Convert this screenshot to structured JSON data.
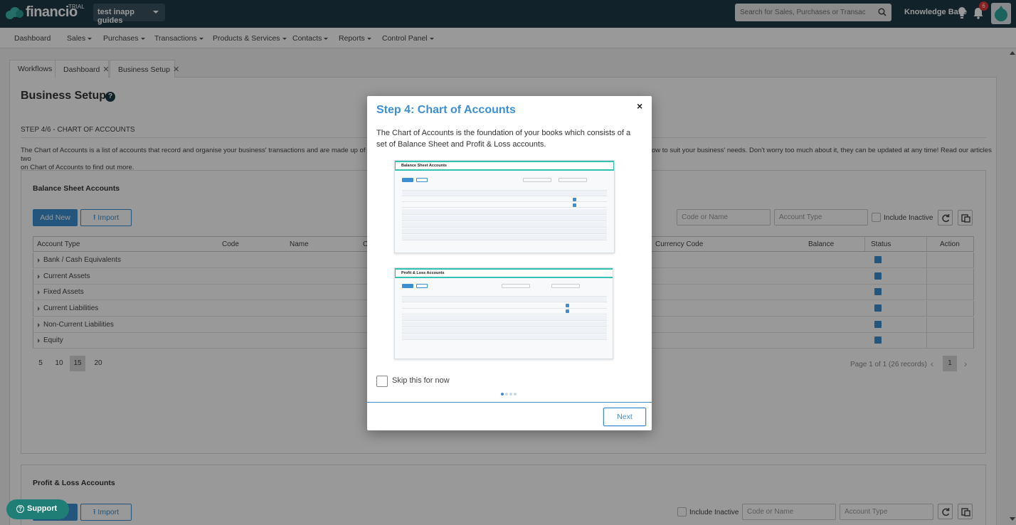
{
  "topbar": {
    "logo_text": "financio",
    "trial_label": "TRIAL",
    "org_name": "test inapp guides",
    "search_placeholder": "Search for Sales, Purchases or Transactions",
    "knowledge_base": "Knowledge Base",
    "notification_count": "6"
  },
  "nav": {
    "items": [
      "Dashboard",
      "Sales",
      "Purchases",
      "Transactions",
      "Products & Services",
      "Contacts",
      "Reports",
      "Control Panel"
    ]
  },
  "tabs": [
    {
      "label": "Workflows"
    },
    {
      "label": "Dashboard"
    },
    {
      "label": "Business Setup"
    }
  ],
  "page": {
    "title": "Business Setup",
    "step_label": "STEP 4/6 - CHART OF ACCOUNTS",
    "desc_left_1": "The Chart of Accounts is a list of accounts that record and organise your business' transactions and are made up of two",
    "desc_left_2": "on Chart of Accounts to find out more.",
    "desc_right": "ow to suit your business' needs. Don't worry too much about it, they can be updated at any time! Read our articles"
  },
  "balance_sheet": {
    "title": "Balance Sheet Accounts",
    "add_new": "Add New",
    "import": "Import",
    "code_placeholder": "Code or Name",
    "type_placeholder": "Account Type",
    "include_inactive": "Include Inactive",
    "columns": {
      "account_type": "Account Type",
      "code": "Code",
      "name": "Name",
      "c": "C",
      "currency_code": "Currency Code",
      "balance": "Balance",
      "status": "Status",
      "action": "Action"
    },
    "rows": [
      "Bank / Cash Equivalents",
      "Current Assets",
      "Fixed Assets",
      "Current Liabilities",
      "Non-Current Liabilities",
      "Equity"
    ],
    "page_sizes": [
      "5",
      "10",
      "15",
      "20"
    ],
    "page_info": "Page 1 of 1 (26 records)",
    "current_page": "1"
  },
  "profit_loss": {
    "title": "Profit & Loss Accounts",
    "import": "Import",
    "include_inactive": "Include Inactive",
    "code_placeholder": "Code or Name",
    "type_placeholder": "Account Type"
  },
  "support": {
    "label": "Support"
  },
  "modal": {
    "title": "Step 4: Chart of Accounts",
    "close": "×",
    "body": "The Chart of Accounts is the foundation of your books which consists of a set of Balance Sheet and Profit & Loss accounts.",
    "shot1_title": "Balance Sheet Accounts",
    "shot2_title": "Profit & Loss Accounts",
    "skip_label": "Skip this for now",
    "next_label": "Next",
    "steps_total": 4,
    "step_current": 1
  },
  "colors": {
    "topbar": "#1f3a48",
    "accent": "#3d8fd1",
    "teal": "#33c1b0",
    "support": "#1f7f77",
    "badge": "#e03a3a"
  }
}
